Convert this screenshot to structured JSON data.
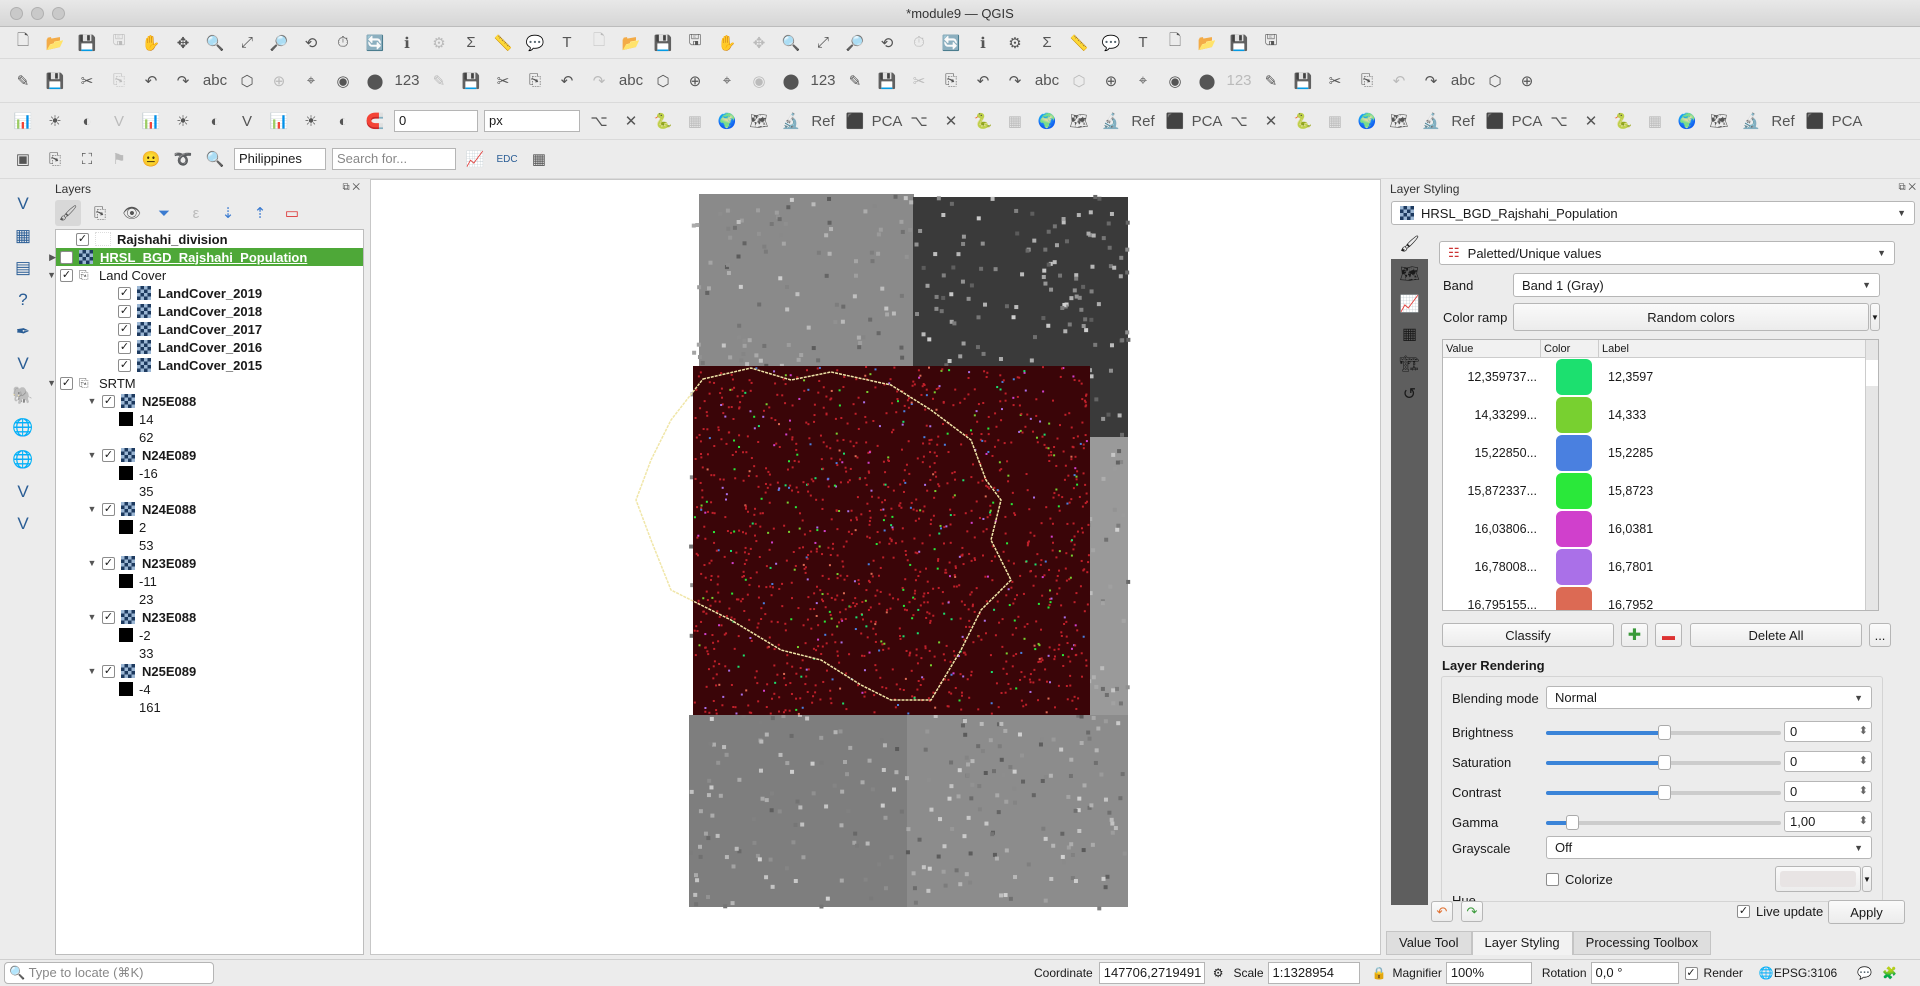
{
  "window": {
    "title": "*module9 — QGIS"
  },
  "toolbar": {
    "snap_tolerance": "0",
    "snap_units": "px",
    "locate_country": "Philippines",
    "search_placeholder": "Search for..."
  },
  "layers_panel": {
    "title": "Layers",
    "items": [
      {
        "name": "Rajshahi_division",
        "indent": 0,
        "type": "vector",
        "bold": true,
        "checked": true
      },
      {
        "name": "HRSL_BGD_Rajshahi_Population",
        "indent": 0,
        "type": "raster",
        "bold": true,
        "checked": true,
        "selected": true,
        "expander": "right"
      },
      {
        "name": "Land Cover",
        "indent": 0,
        "type": "group",
        "checked": true,
        "expander": "down"
      },
      {
        "name": "LandCover_2019",
        "indent": 1,
        "type": "raster",
        "bold": true,
        "checked": true
      },
      {
        "name": "LandCover_2018",
        "indent": 1,
        "type": "raster",
        "bold": true,
        "checked": true
      },
      {
        "name": "LandCover_2017",
        "indent": 1,
        "type": "raster",
        "bold": true,
        "checked": true
      },
      {
        "name": "LandCover_2016",
        "indent": 1,
        "type": "raster",
        "bold": true,
        "checked": true
      },
      {
        "name": "LandCover_2015",
        "indent": 1,
        "type": "raster",
        "bold": true,
        "checked": true
      },
      {
        "name": "SRTM",
        "indent": 0,
        "type": "group",
        "checked": true,
        "expander": "down"
      },
      {
        "name": "N25E088",
        "indent": 1,
        "type": "raster",
        "bold": true,
        "checked": true,
        "expander": "down",
        "legend": [
          "14",
          "62"
        ]
      },
      {
        "name": "N24E089",
        "indent": 1,
        "type": "raster",
        "bold": true,
        "checked": true,
        "expander": "down",
        "legend": [
          "-16",
          "35"
        ]
      },
      {
        "name": "N24E088",
        "indent": 1,
        "type": "raster",
        "bold": true,
        "checked": true,
        "expander": "down",
        "legend": [
          "2",
          "53"
        ]
      },
      {
        "name": "N23E089",
        "indent": 1,
        "type": "raster",
        "bold": true,
        "checked": true,
        "expander": "down",
        "legend": [
          "-11",
          "23"
        ]
      },
      {
        "name": "N23E088",
        "indent": 1,
        "type": "raster",
        "bold": true,
        "checked": true,
        "expander": "down",
        "legend": [
          "-2",
          "33"
        ]
      },
      {
        "name": "N25E089",
        "indent": 1,
        "type": "raster",
        "bold": true,
        "checked": true,
        "expander": "down",
        "legend": [
          "-4",
          "161"
        ]
      }
    ]
  },
  "styling": {
    "title": "Layer Styling",
    "layer": "HRSL_BGD_Rajshahi_Population",
    "renderer": "Paletted/Unique values",
    "band_label": "Band",
    "band": "Band 1 (Gray)",
    "ramp_label": "Color ramp",
    "ramp": "Random colors",
    "columns": [
      "Value",
      "Color",
      "Label"
    ],
    "classes": [
      {
        "value": "12,359737...",
        "color": "#1ce06f",
        "label": "12,3597"
      },
      {
        "value": "14,33299...",
        "color": "#78d030",
        "label": "14,333"
      },
      {
        "value": "15,22850...",
        "color": "#4a80e0",
        "label": "15,2285"
      },
      {
        "value": "15,872337...",
        "color": "#2ae83a",
        "label": "15,8723"
      },
      {
        "value": "16,03806...",
        "color": "#d040cc",
        "label": "16,0381"
      },
      {
        "value": "16,78008...",
        "color": "#aa70e8",
        "label": "16,7801"
      },
      {
        "value": "16,795155...",
        "color": "#dc6a54",
        "label": "16,7952"
      }
    ],
    "classify": "Classify",
    "delete_all": "Delete All",
    "more": "...",
    "rendering_title": "Layer Rendering",
    "blending_label": "Blending mode",
    "blending": "Normal",
    "brightness_label": "Brightness",
    "brightness": "0",
    "brightness_pct": 50,
    "saturation_label": "Saturation",
    "saturation": "0",
    "saturation_pct": 50,
    "contrast_label": "Contrast",
    "contrast": "0",
    "contrast_pct": 50,
    "gamma_label": "Gamma",
    "gamma": "1,00",
    "gamma_pct": 11,
    "grayscale_label": "Grayscale",
    "grayscale": "Off",
    "colorize_label": "Colorize",
    "hue_label": "Hue",
    "live_update": "Live update",
    "apply": "Apply"
  },
  "dock_tabs": [
    "Value Tool",
    "Layer Styling",
    "Processing Toolbox"
  ],
  "status": {
    "locate_placeholder": "Type to locate (⌘K)",
    "coordinate_label": "Coordinate",
    "coordinate": "147706,2719491",
    "scale_label": "Scale",
    "scale": "1:1328954",
    "magnifier_label": "Magnifier",
    "magnifier": "100%",
    "rotation_label": "Rotation",
    "rotation": "0,0 °",
    "render_label": "Render",
    "crs": "EPSG:3106"
  }
}
